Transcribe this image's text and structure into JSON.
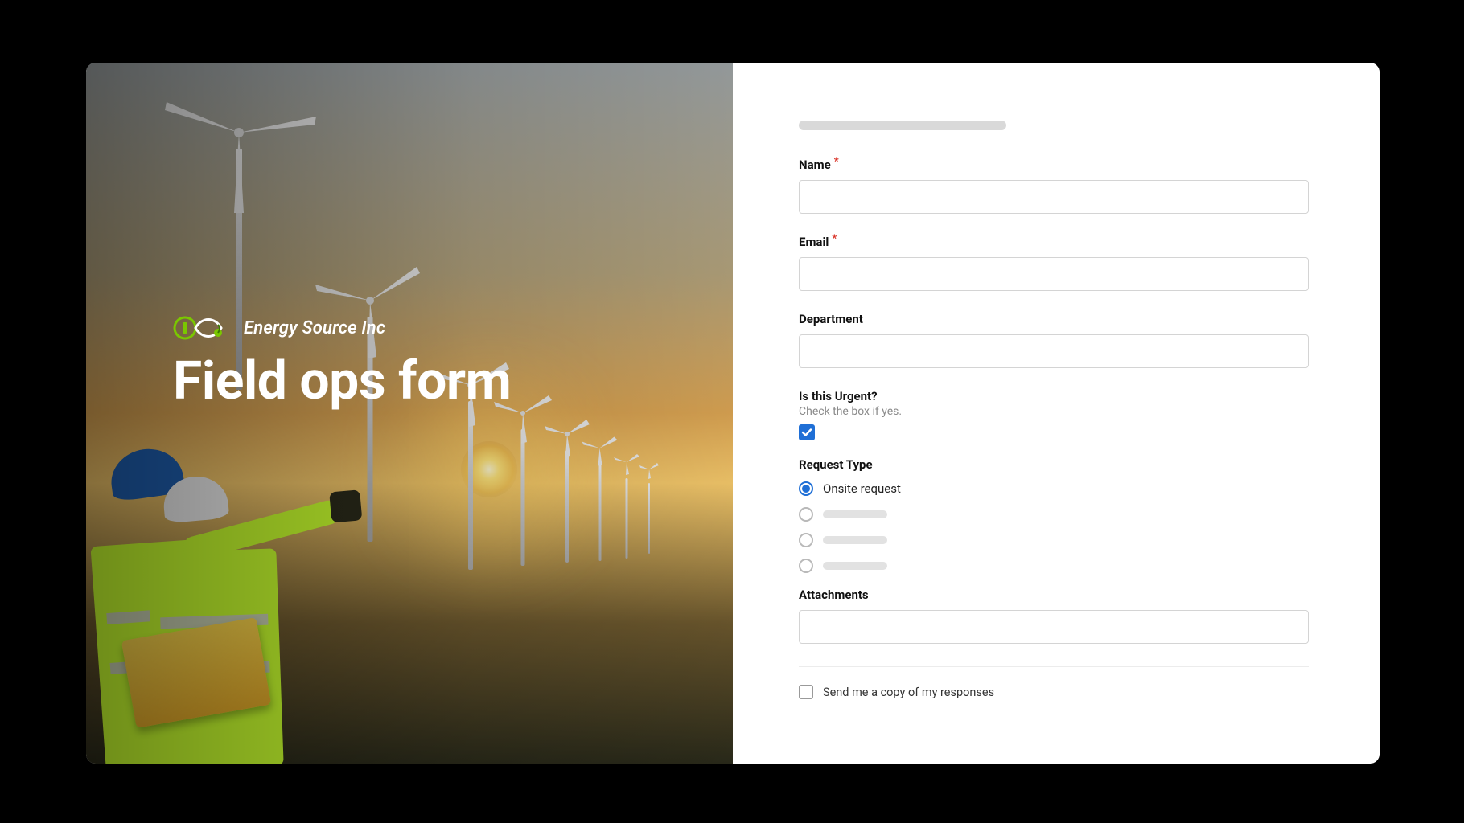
{
  "brand": {
    "name": "Energy Source Inc"
  },
  "title": "Field ops form",
  "form": {
    "name": {
      "label": "Name",
      "required": true,
      "value": ""
    },
    "email": {
      "label": "Email",
      "required": true,
      "value": ""
    },
    "department": {
      "label": "Department",
      "required": false,
      "value": ""
    },
    "urgent": {
      "label": "Is this Urgent?",
      "helper": "Check the box if yes.",
      "checked": true
    },
    "request_type": {
      "label": "Request Type",
      "selected_index": 0,
      "options": [
        {
          "label": "Onsite request",
          "placeholder": false
        },
        {
          "label": "",
          "placeholder": true
        },
        {
          "label": "",
          "placeholder": true
        },
        {
          "label": "",
          "placeholder": true
        }
      ]
    },
    "attachments": {
      "label": "Attachments"
    },
    "send_copy": {
      "label": "Send me a copy of my responses",
      "checked": false
    }
  }
}
